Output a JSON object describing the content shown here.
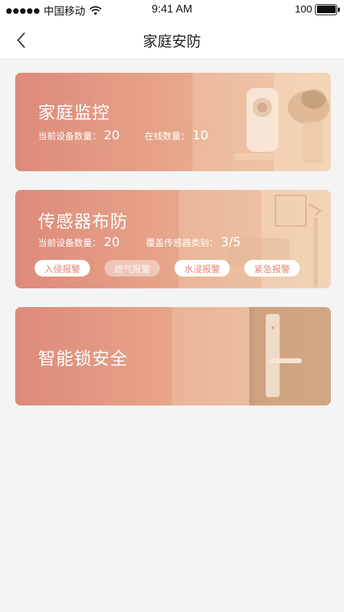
{
  "status_bar": {
    "carrier": "中国移动",
    "time": "9:41 AM",
    "battery": "100"
  },
  "nav": {
    "title": "家庭安防",
    "back_icon": "chevron-left-icon"
  },
  "cards": [
    {
      "title": "家庭监控",
      "stats": [
        {
          "label": "当前设备数量：",
          "value": "20"
        },
        {
          "label": "在线数量：",
          "value": "10"
        }
      ],
      "illustration": "camera-icon"
    },
    {
      "title": "传感器布防",
      "stats": [
        {
          "label": "当前设备数量：",
          "value": "20"
        },
        {
          "label": "覆盖传感器类别：",
          "value": "3/5"
        }
      ],
      "tags": [
        {
          "label": "入侵报警",
          "active": true
        },
        {
          "label": "燃气报警",
          "active": false
        },
        {
          "label": "水浸报警",
          "active": true
        },
        {
          "label": "紧急报警",
          "active": true
        }
      ],
      "illustration": "living-room-icon"
    },
    {
      "title": "智能锁安全",
      "illustration": "door-lock-icon"
    }
  ],
  "colors": {
    "gradient_start": "#de8a7a",
    "gradient_end": "#edc4a1",
    "tag_text": "#e08777",
    "background": "#f4f4f4"
  }
}
